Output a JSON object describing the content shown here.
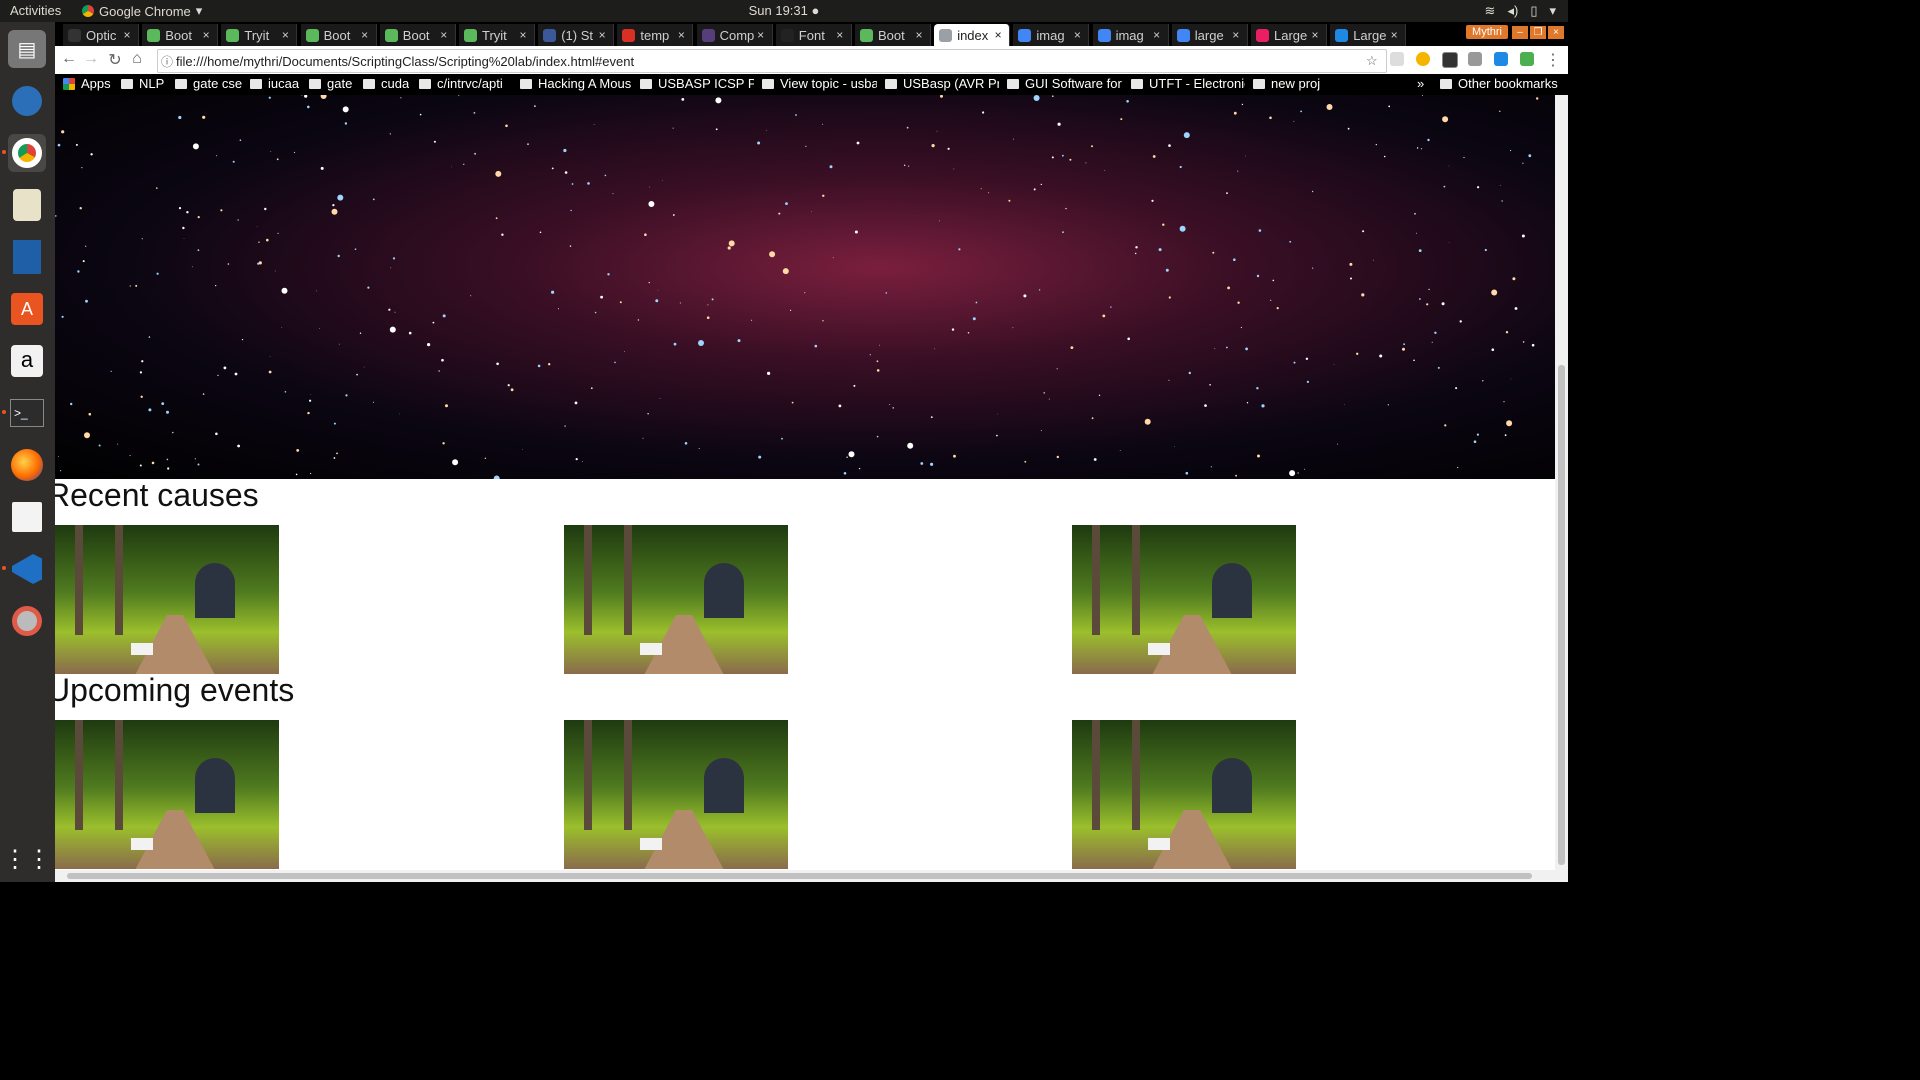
{
  "topbar": {
    "activities": "Activities",
    "app_name": "Google Chrome",
    "clock": "Sun 19:31"
  },
  "tabs": [
    {
      "label": "Optic",
      "color": "#333333"
    },
    {
      "label": "Boot",
      "color": "#5cb85c"
    },
    {
      "label": "Tryit",
      "color": "#5cb85c"
    },
    {
      "label": "Boot",
      "color": "#5cb85c"
    },
    {
      "label": "Boot",
      "color": "#5cb85c"
    },
    {
      "label": "Tryit",
      "color": "#5cb85c"
    },
    {
      "label": "(1) St",
      "color": "#3b5998"
    },
    {
      "label": "temp",
      "color": "#d93025"
    },
    {
      "label": "Comp",
      "color": "#563d7c"
    },
    {
      "label": "Font",
      "color": "#222222"
    },
    {
      "label": "Boot",
      "color": "#5cb85c"
    },
    {
      "label": "index",
      "color": "#ffffff"
    },
    {
      "label": "imag",
      "color": "#4285f4"
    },
    {
      "label": "imag",
      "color": "#4285f4"
    },
    {
      "label": "large",
      "color": "#4285f4"
    },
    {
      "label": "Large",
      "color": "#e91e63"
    },
    {
      "label": "Large",
      "color": "#1e88e5"
    }
  ],
  "user": "Mythri",
  "address": "file:///home/mythri/Documents/ScriptingClass/Scripting%20lab/index.html#event",
  "bookmarks": [
    "Apps",
    "NLP",
    "gate cse",
    "iucaa",
    "gate",
    "cuda",
    "c/intrvc/apti",
    "Hacking A Mous",
    "USBASP ICSP Pro",
    "View topic - usba",
    "USBasp (AVR Pro",
    "GUI Software for",
    "UTFT - Electronic",
    "new proj"
  ],
  "bookmarks_more": "»",
  "other_bookmarks": "Other bookmarks",
  "page": {
    "recent_heading": "Recent causes",
    "upcoming_heading": "Upcoming events"
  },
  "colors": {
    "accent": "#e95420",
    "badge": "#e0782b"
  }
}
